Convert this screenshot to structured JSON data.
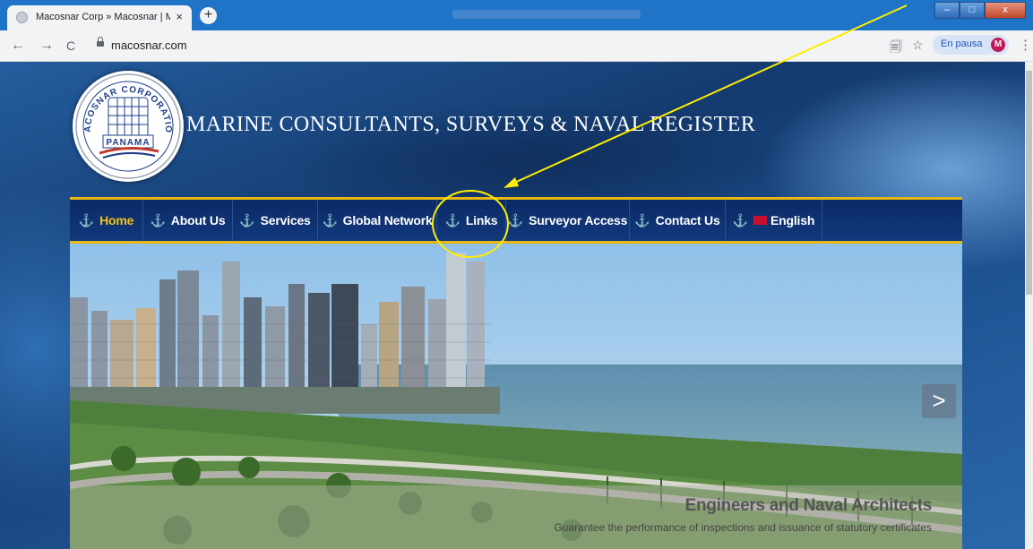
{
  "browser": {
    "tab_title": "Macosnar Corp » Macosnar | Ma",
    "tab_close": "×",
    "new_tab": "+",
    "nav_back": "←",
    "nav_forward": "→",
    "nav_reload": "C",
    "url": "macosnar.com",
    "translate_icon": "🗐",
    "star_icon": "☆",
    "profile_status": "En pausa",
    "profile_initial": "M",
    "menu": "⋮",
    "win_minimize": "–",
    "win_maximize": "□",
    "win_close": "x"
  },
  "site": {
    "logo_top_text": "MACOSNAR CORPORATION",
    "logo_bottom_text": "PANAMA",
    "title": "MARINE CONSULTANTS, SURVEYS & NAVAL REGISTER"
  },
  "nav": {
    "anchor_glyph": "⚓",
    "items": [
      {
        "label": "Home"
      },
      {
        "label": "About Us"
      },
      {
        "label": "Services"
      },
      {
        "label": "Global Network"
      },
      {
        "label": "Links"
      },
      {
        "label": "Surveyor Access"
      },
      {
        "label": "Contact Us"
      },
      {
        "label": "English"
      }
    ]
  },
  "hero": {
    "next": ">",
    "caption_title": "Engineers and Naval Architects",
    "caption_subtitle": "Guarantee the performance of inspections and issuance of statutory certificates"
  },
  "colors": {
    "nav_bg": "#0b2a66",
    "nav_border": "#e6b80f",
    "annotation": "#ffee00"
  }
}
